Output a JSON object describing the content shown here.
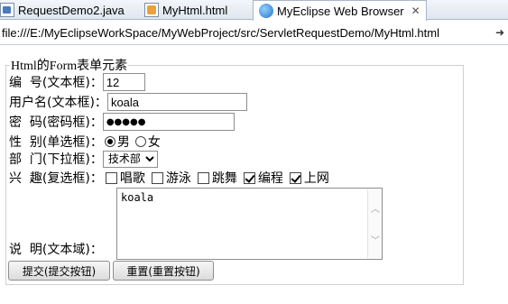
{
  "tabs": [
    {
      "label": "RequestDemo2.java",
      "icon": "java-file-icon"
    },
    {
      "label": "MyHtml.html",
      "icon": "html-file-icon"
    },
    {
      "label": "MyEclipse Web Browser",
      "icon": "globe-icon",
      "close": "✕"
    }
  ],
  "address": {
    "url": "file:///E:/MyEclipseWorkSpace/MyWebProject/src/ServletRequestDemo/MyHtml.html",
    "go_icon": "arrow-right-icon"
  },
  "form": {
    "legend": "Html的Form表单元素",
    "number": {
      "label": "编  号(文本框)：",
      "value": "12"
    },
    "username": {
      "label": "用户名(文本框)：",
      "value": "koala"
    },
    "password": {
      "label": "密  码(密码框)：",
      "value": "●●●●●"
    },
    "gender": {
      "label": "性  别(单选框)：",
      "options": [
        {
          "label": "男",
          "checked": true
        },
        {
          "label": "女",
          "checked": false
        }
      ]
    },
    "department": {
      "label": "部  门(下拉框)：",
      "selected": "技术部"
    },
    "hobbies": {
      "label": "兴  趣(复选框)：",
      "options": [
        {
          "label": "唱歌",
          "checked": false
        },
        {
          "label": "游泳",
          "checked": false
        },
        {
          "label": "跳舞",
          "checked": false
        },
        {
          "label": "编程",
          "checked": true
        },
        {
          "label": "上网",
          "checked": true
        }
      ]
    },
    "description": {
      "label": "说  明(文本域)：",
      "value": "koala"
    },
    "submit_label": "提交(提交按钮)",
    "reset_label": "重置(重置按钮)"
  }
}
